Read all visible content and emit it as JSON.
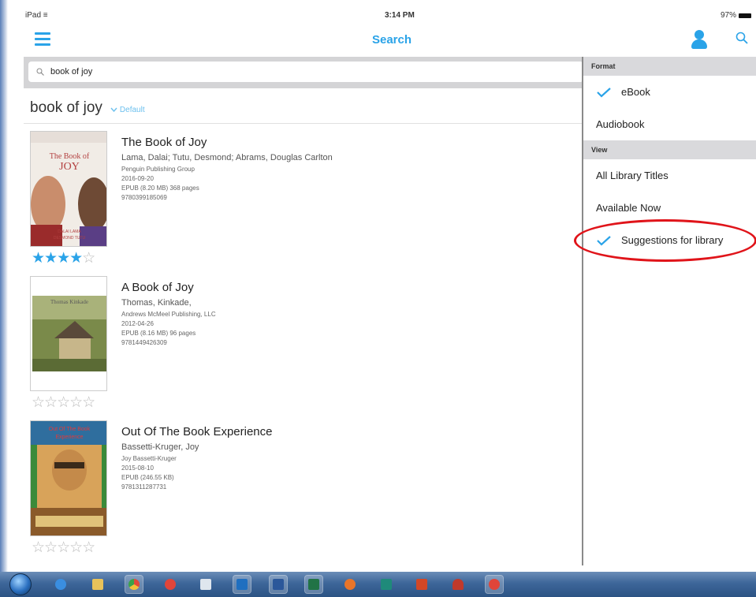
{
  "status_bar": {
    "device": "iPad ≡",
    "time": "3:14 PM",
    "battery": "97%"
  },
  "nav": {
    "title": "Search"
  },
  "search": {
    "value": "book of joy",
    "placeholder": "Search"
  },
  "results_header": {
    "query": "book of joy",
    "sort": "Default"
  },
  "books": [
    {
      "title": "The Book of Joy",
      "author": "Lama, Dalai; Tutu, Desmond; Abrams, Douglas Carlton",
      "publisher": "Penguin Publishing Group",
      "date": "2016-09-20",
      "format": "EPUB (8.20 MB) 368 pages",
      "isbn": "9780399185069",
      "rating": 4,
      "rating_max": 5,
      "cover_title": "The Book of JOY"
    },
    {
      "title": "A Book of Joy",
      "author": "Thomas, Kinkade,",
      "publisher": "Andrews McMeel Publishing, LLC",
      "date": "2012-04-26",
      "format": "EPUB (8.16 MB) 96 pages",
      "isbn": "9781449426309",
      "rating": 0,
      "rating_max": 5,
      "cover_title": "Thomas Kinkade"
    },
    {
      "title": "Out Of The Book Experience",
      "author": "Bassetti-Kruger, Joy",
      "publisher": "Joy Bassetti-Kruger",
      "date": "2015-08-10",
      "format": "EPUB (246.55 KB)",
      "isbn": "9781311287731",
      "rating": 0,
      "rating_max": 5,
      "cover_title": "Out Of The Book Experience"
    }
  ],
  "filter_panel": {
    "format_header": "Format",
    "format_items": [
      {
        "label": "eBook",
        "checked": true
      },
      {
        "label": "Audiobook",
        "checked": false
      }
    ],
    "view_header": "View",
    "view_items": [
      {
        "label": "All Library Titles",
        "checked": false
      },
      {
        "label": "Available Now",
        "checked": false
      },
      {
        "label": "Suggestions for library",
        "checked": true
      }
    ]
  },
  "taskbar": {
    "apps": [
      "internet-explorer-icon",
      "file-explorer-icon",
      "chrome-icon",
      "red-app-icon",
      "notepad-icon",
      "outlook-icon",
      "word-icon",
      "excel-icon",
      "firefox-icon",
      "publisher-icon",
      "powerpoint-icon",
      "remote-app-icon",
      "red-app-icon-2"
    ]
  },
  "colors": {
    "accent": "#2aa3e8",
    "highlight_ellipse": "#e0141a",
    "taskbar": "#3d6699"
  }
}
